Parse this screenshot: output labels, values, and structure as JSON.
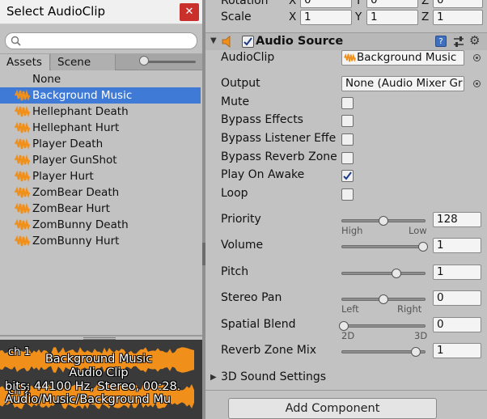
{
  "picker": {
    "title": "Select AudioClip",
    "close_icon": "close-icon",
    "search": {
      "placeholder": "",
      "value": ""
    },
    "tabs": [
      {
        "label": "Assets",
        "active": true
      },
      {
        "label": "Scene",
        "active": false
      }
    ],
    "items": [
      {
        "label": "None",
        "icon": false,
        "selected": false
      },
      {
        "label": "Background Music",
        "icon": true,
        "selected": true
      },
      {
        "label": "Hellephant Death",
        "icon": true,
        "selected": false
      },
      {
        "label": "Hellephant Hurt",
        "icon": true,
        "selected": false
      },
      {
        "label": "Player Death",
        "icon": true,
        "selected": false
      },
      {
        "label": "Player GunShot",
        "icon": true,
        "selected": false
      },
      {
        "label": "Player Hurt",
        "icon": true,
        "selected": false
      },
      {
        "label": "ZomBear Death",
        "icon": true,
        "selected": false
      },
      {
        "label": "ZomBear Hurt",
        "icon": true,
        "selected": false
      },
      {
        "label": "ZomBunny Death",
        "icon": true,
        "selected": false
      },
      {
        "label": "ZomBunny Hurt",
        "icon": true,
        "selected": false
      }
    ],
    "preview": {
      "ch1": "ch 1",
      "ch2": "ch 2",
      "line1": "Background Music",
      "line2": "Audio Clip",
      "line3": "bits: 44100 Hz, Stereo, 00:28.",
      "line4": "Audio/Music/Background Mu",
      "wave_color": "#f0901a"
    }
  },
  "transform": {
    "rotation_label": "Rotation",
    "rotation": {
      "x": "0",
      "y": "0",
      "z": "0"
    },
    "scale_label": "Scale",
    "scale": {
      "x": "1",
      "y": "1",
      "z": "1"
    },
    "axes": {
      "x": "X",
      "y": "Y",
      "z": "Z"
    }
  },
  "audio_source": {
    "title": "Audio Source",
    "enabled": true,
    "audioclip_label": "AudioClip",
    "audioclip_value": "Background Music",
    "output_label": "Output",
    "output_value": "None (Audio Mixer Gr",
    "toggles": [
      {
        "label": "Mute",
        "checked": false
      },
      {
        "label": "Bypass Effects",
        "checked": false
      },
      {
        "label": "Bypass Listener Effe",
        "checked": false
      },
      {
        "label": "Bypass Reverb Zone",
        "checked": false
      },
      {
        "label": "Play On Awake",
        "checked": true
      },
      {
        "label": "Loop",
        "checked": false
      }
    ],
    "sliders": [
      {
        "label": "Priority",
        "value": "128",
        "level": 0.5,
        "min_label": "High",
        "max_label": "Low"
      },
      {
        "label": "Volume",
        "value": "1",
        "level": 1.0,
        "min_label": "",
        "max_label": ""
      },
      {
        "label": "Pitch",
        "value": "1",
        "level": 0.667,
        "min_label": "",
        "max_label": ""
      },
      {
        "label": "Stereo Pan",
        "value": "0",
        "level": 0.5,
        "min_label": "Left",
        "max_label": "Right"
      },
      {
        "label": "Spatial Blend",
        "value": "0",
        "level": 0.0,
        "min_label": "2D",
        "max_label": "3D"
      },
      {
        "label": "Reverb Zone Mix",
        "value": "1",
        "level": 0.909,
        "min_label": "",
        "max_label": ""
      }
    ],
    "sound_3d_label": "3D Sound Settings"
  },
  "add_component_label": "Add Component",
  "colors": {
    "selection": "#3e7ad6",
    "close": "#c9302c",
    "audio_icon": "#f0901a"
  }
}
